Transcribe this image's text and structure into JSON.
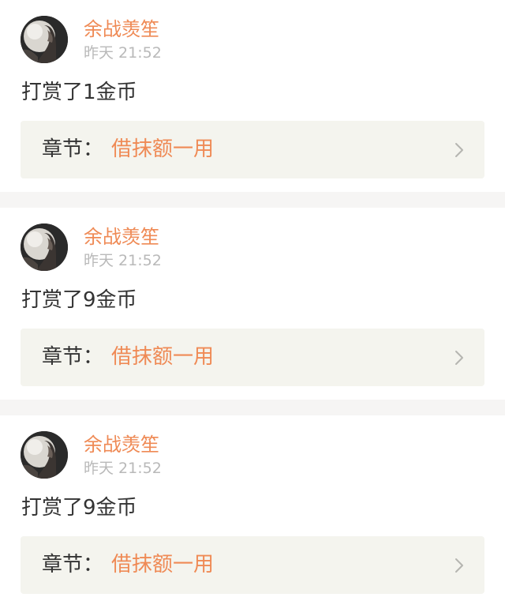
{
  "theme": {
    "accent": "#ef8a55",
    "text": "#333333",
    "muted": "#b9b9b9",
    "card": "#f4f4ee",
    "separator": "#f6f5f4"
  },
  "entries": [
    {
      "avatar_icon": "user-avatar-icon",
      "username": "余战羡笙",
      "timestamp": "昨天 21:52",
      "reward": "打赏了1金币",
      "chapter_label": "章节：",
      "chapter_title": "借抹额一用",
      "chevron_icon": "chevron-right-icon"
    },
    {
      "avatar_icon": "user-avatar-icon",
      "username": "余战羡笙",
      "timestamp": "昨天 21:52",
      "reward": "打赏了9金币",
      "chapter_label": "章节：",
      "chapter_title": "借抹额一用",
      "chevron_icon": "chevron-right-icon"
    },
    {
      "avatar_icon": "user-avatar-icon",
      "username": "余战羡笙",
      "timestamp": "昨天 21:52",
      "reward": "打赏了9金币",
      "chapter_label": "章节：",
      "chapter_title": "借抹额一用",
      "chevron_icon": "chevron-right-icon"
    }
  ]
}
